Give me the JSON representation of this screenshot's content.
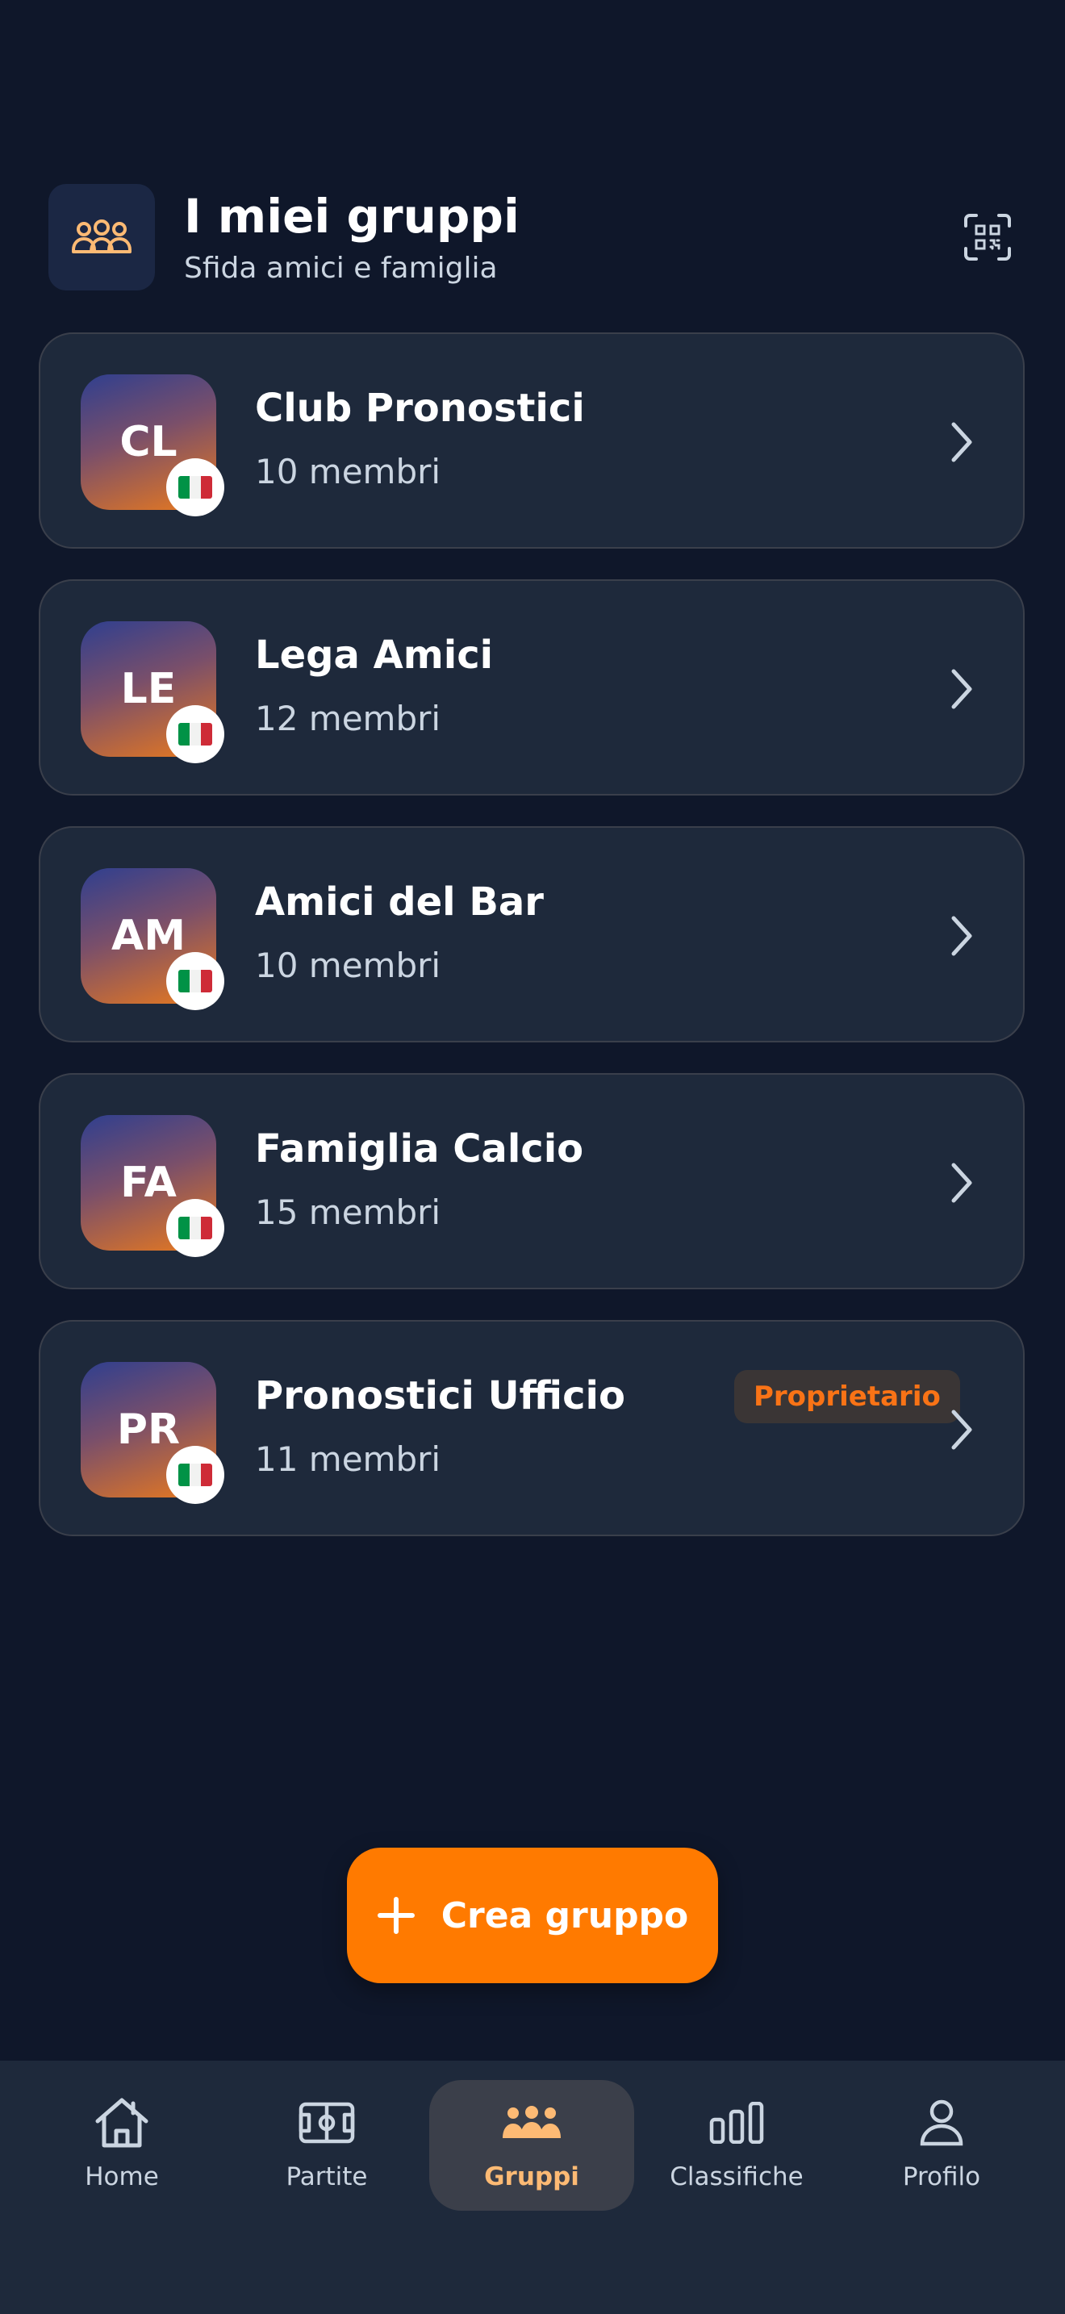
{
  "header": {
    "title": "I miei gruppi",
    "subtitle": "Sfida amici e famiglia",
    "icon": "users-icon",
    "action_icon": "qr-code-scan-icon"
  },
  "groups": [
    {
      "initials": "CL",
      "name": "Club Pronostici",
      "members": "10 membri",
      "flag": "italy-flag",
      "badge": ""
    },
    {
      "initials": "LE",
      "name": "Lega Amici",
      "members": "12 membri",
      "flag": "italy-flag",
      "badge": ""
    },
    {
      "initials": "AM",
      "name": "Amici del Bar",
      "members": "10 membri",
      "flag": "italy-flag",
      "badge": ""
    },
    {
      "initials": "FA",
      "name": "Famiglia Calcio",
      "members": "15 membri",
      "flag": "italy-flag",
      "badge": ""
    },
    {
      "initials": "PR",
      "name": "Pronostici Ufficio",
      "members": "11 membri",
      "flag": "italy-flag",
      "badge": "Proprietario"
    }
  ],
  "create_button": {
    "label": "Crea gruppo",
    "icon": "plus-icon"
  },
  "nav": [
    {
      "label": "Home",
      "icon": "home-icon",
      "active": false
    },
    {
      "label": "Partite",
      "icon": "field-icon",
      "active": false
    },
    {
      "label": "Gruppi",
      "icon": "users-icon",
      "active": true
    },
    {
      "label": "Classifiche",
      "icon": "bar-chart-icon",
      "active": false
    },
    {
      "label": "Profilo",
      "icon": "user-icon",
      "active": false
    }
  ],
  "colors": {
    "background": "#0f172a",
    "card": "#1e293b",
    "accent": "#ff7a00",
    "accent_light": "#fdba74",
    "muted_text": "#cbd5e1"
  }
}
